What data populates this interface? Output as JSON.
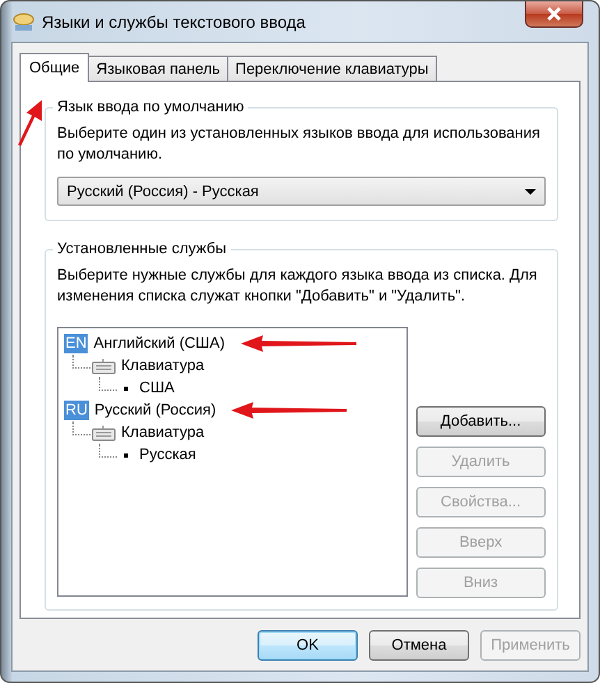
{
  "window": {
    "title": "Языки и службы текстового ввода"
  },
  "tabs": [
    {
      "label": "Общие",
      "selected": true
    },
    {
      "label": "Языковая панель",
      "selected": false
    },
    {
      "label": "Переключение клавиатуры",
      "selected": false
    }
  ],
  "default_language": {
    "title": "Язык ввода по умолчанию",
    "description": "Выберите один из установленных языков ввода для использования по умолчанию.",
    "dropdown": {
      "value": "Русский (Россия) - Русская"
    }
  },
  "installed_services": {
    "title": "Установленные службы",
    "description": "Выберите нужные службы для каждого языка ввода из списка. Для изменения списка служат кнопки \"Добавить\" и \"Удалить\".",
    "tree": [
      {
        "kind": "language",
        "badge": "EN",
        "label": "Английский (США)",
        "children": [
          {
            "kind": "input_type",
            "label": "Клавиатура",
            "children": [
              {
                "kind": "layout",
                "label": "США"
              }
            ]
          }
        ]
      },
      {
        "kind": "language",
        "badge": "RU",
        "label": "Русский (Россия)",
        "children": [
          {
            "kind": "input_type",
            "label": "Клавиатура",
            "children": [
              {
                "kind": "layout",
                "label": "Русская"
              }
            ]
          }
        ]
      }
    ],
    "buttons": [
      {
        "label": "Добавить...",
        "disabled": false
      },
      {
        "label": "Удалить",
        "disabled": true
      },
      {
        "label": "Свойства...",
        "disabled": true
      },
      {
        "label": "Вверх",
        "disabled": true
      },
      {
        "label": "Вниз",
        "disabled": true
      }
    ]
  },
  "buttons": [
    {
      "label": "OK",
      "default": true,
      "disabled": false
    },
    {
      "label": "Отмена",
      "default": false,
      "disabled": false
    },
    {
      "label": "Применить",
      "default": false,
      "disabled": true
    }
  ]
}
